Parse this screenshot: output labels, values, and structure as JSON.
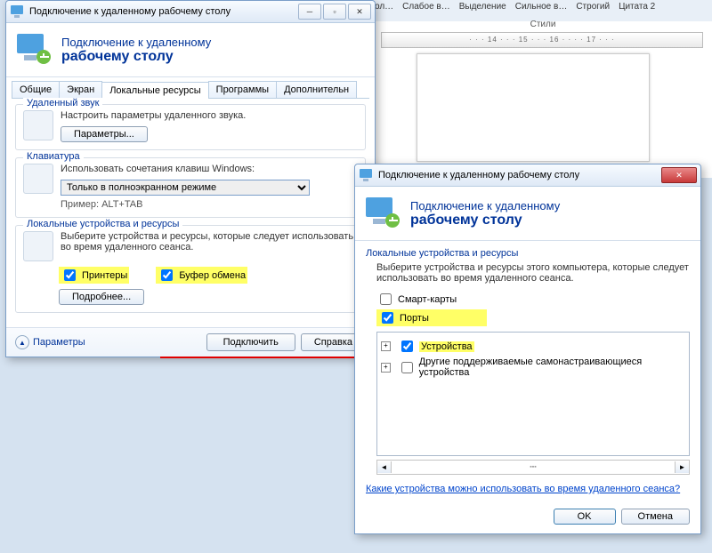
{
  "bg": {
    "ribbon": [
      "агол…",
      "Слабое в…",
      "Выделение",
      "Сильное в…",
      "Строгий",
      "Цитата 2"
    ],
    "styles_label": "Стили",
    "ruler": "· · · 14 · · · 15 · · · 16 · · · · 17 · · ·"
  },
  "win1": {
    "title": "Подключение к удаленному рабочему столу",
    "header_l1": "Подключение к удаленному",
    "header_l2": "рабочему столу",
    "tabs": [
      "Общие",
      "Экран",
      "Локальные ресурсы",
      "Программы",
      "Дополнительн"
    ],
    "sound": {
      "title": "Удаленный звук",
      "desc": "Настроить параметры удаленного звука.",
      "btn": "Параметры..."
    },
    "kbd": {
      "title": "Клавиатура",
      "desc": "Использовать сочетания клавиш Windows:",
      "combo": "Только в полноэкранном режиме",
      "example": "Пример: ALT+TAB"
    },
    "dev": {
      "title": "Локальные устройства и ресурсы",
      "desc": "Выберите устройства и ресурсы, которые следует использовать во время удаленного сеанса.",
      "chk_printers": "Принтеры",
      "chk_clip": "Буфер обмена",
      "more_btn": "Подробнее..."
    },
    "options_label": "Параметры",
    "connect_btn": "Подключить",
    "help_btn": "Справка"
  },
  "win2": {
    "title": "Подключение к удаленному рабочему столу",
    "header_l1": "Подключение к удаленному",
    "header_l2": "рабочему столу",
    "group_title": "Локальные устройства и ресурсы",
    "desc": "Выберите устройства и ресурсы этого компьютера, которые следует использовать во время удаленного сеанса.",
    "chk_smart": "Смарт-карты",
    "chk_ports": "Порты",
    "chk_drives": "Устройства",
    "chk_other": "Другие поддерживаемые самонастраивающиеся устройства",
    "link": "Какие устройства можно использовать во время удаленного сеанса?",
    "ok": "OK",
    "cancel": "Отмена"
  }
}
